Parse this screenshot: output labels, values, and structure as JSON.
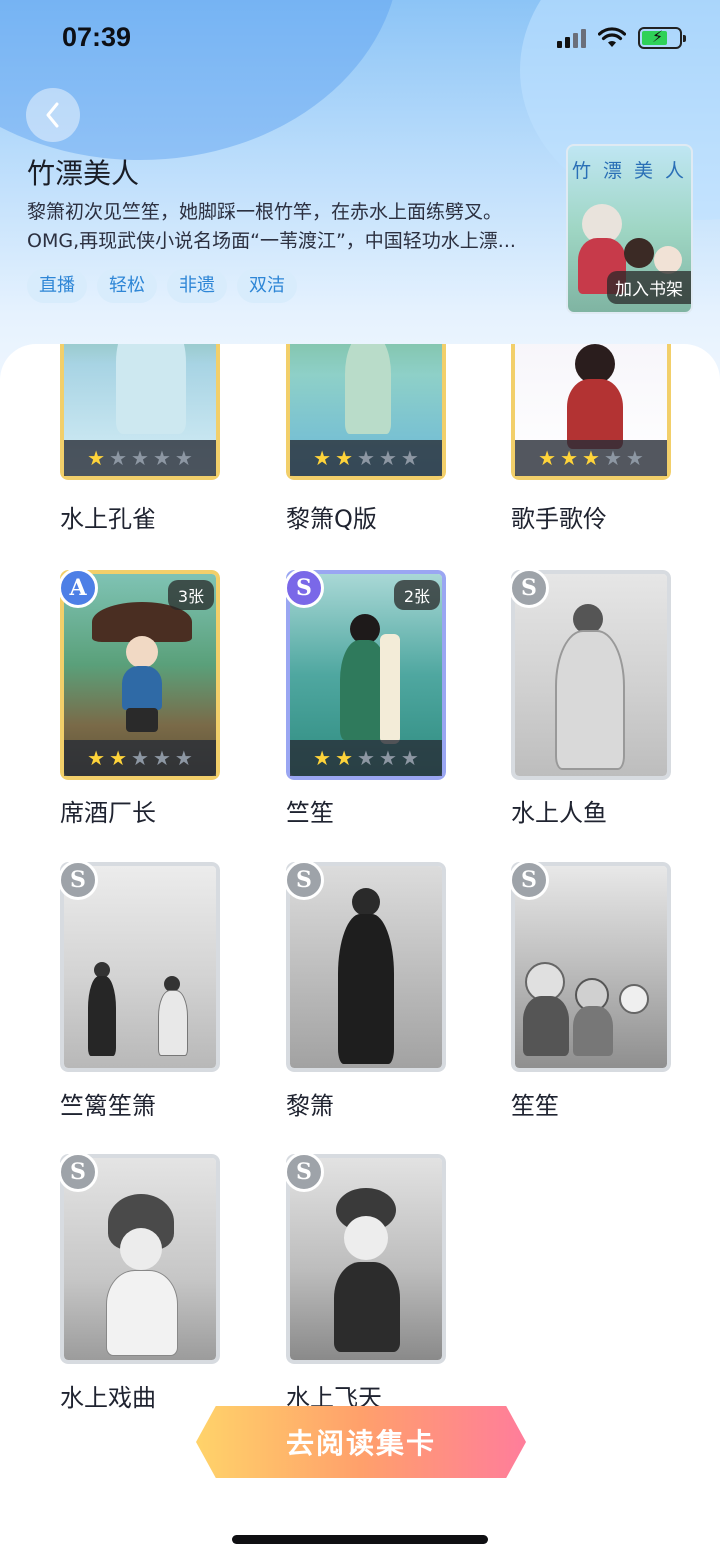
{
  "status": {
    "time": "07:39"
  },
  "book": {
    "title": "竹漂美人",
    "desc_line1": "黎箫初次见竺笙，她脚踩一根竹竿，在赤水上面练劈叉。",
    "desc_line2": "OMG,再现武侠小说名场面“一苇渡江”，中国轻功水上漂...",
    "tags": [
      "直播",
      "轻松",
      "非遗",
      "双洁"
    ],
    "cover_title": "竹 漂 美 人",
    "add_shelf_label": "加入书架"
  },
  "cards": [
    {
      "name": "水上孔雀",
      "stars": 1,
      "grade": "",
      "count": ""
    },
    {
      "name": "黎箫Q版",
      "stars": 2,
      "grade": "",
      "count": ""
    },
    {
      "name": "歌手歌伶",
      "stars": 3,
      "grade": "",
      "count": ""
    },
    {
      "name": "席酒厂长",
      "stars": 2,
      "grade": "A",
      "count": "3张"
    },
    {
      "name": "竺笙",
      "stars": 2,
      "grade": "S",
      "count": "2张"
    },
    {
      "name": "水上人鱼",
      "stars": 0,
      "grade": "S",
      "count": ""
    },
    {
      "name": "竺篱笙箫",
      "stars": 0,
      "grade": "S",
      "count": ""
    },
    {
      "name": "黎箫",
      "stars": 0,
      "grade": "S",
      "count": ""
    },
    {
      "name": "笙笙",
      "stars": 0,
      "grade": "S",
      "count": ""
    },
    {
      "name": "水上戏曲",
      "stars": 0,
      "grade": "S",
      "count": ""
    },
    {
      "name": "水上飞天",
      "stars": 0,
      "grade": "S",
      "count": ""
    }
  ],
  "cta": {
    "label": "去阅读集卡"
  },
  "icons": {
    "back": "chevron-left-icon",
    "signal": "cellular-signal-icon",
    "wifi": "wifi-icon",
    "battery": "battery-charging-icon",
    "star": "star-icon"
  },
  "colors": {
    "tag_bg": "#d8ecfc",
    "tag_text": "#2e86d6",
    "star_on": "#ffd43a",
    "cta_start": "#ffd36a",
    "cta_end": "#ff7d9b"
  }
}
